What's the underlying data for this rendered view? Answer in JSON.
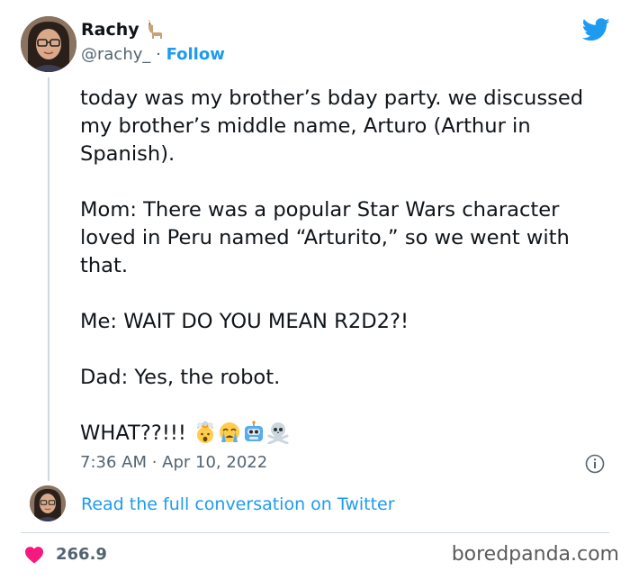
{
  "author": {
    "name": "Rachy",
    "name_emoji": "llama-icon",
    "handle": "@rachy_",
    "separator": " · ",
    "follow_label": "Follow"
  },
  "tweet": {
    "p1": "today was my brother’s bday party. we discussed my brother’s middle name, Arturo (Arthur in Spanish).",
    "p2": "Mom: There was a popular Star Wars character loved in Peru named “Arturito,” so we went with that.",
    "p3": "Me: WAIT DO YOU MEAN R2D2?!",
    "p4": "Dad: Yes, the robot.",
    "p5": "WHAT??!!! ",
    "emojis": [
      "exploding-head-icon",
      "crying-face-icon",
      "robot-icon",
      "skull-crossbones-icon"
    ],
    "timestamp": "7:36 AM · Apr 10, 2022"
  },
  "conversation": {
    "link_text": "Read the full conversation on Twitter"
  },
  "footer": {
    "like_count": "266.9",
    "like_count_suffix": "",
    "watermark": "boredpanda.com"
  },
  "colors": {
    "twitter_blue": "#1d9bf0",
    "text": "#0f1419",
    "muted": "#536471",
    "heart": "#f91880",
    "divider": "#cfd9de"
  }
}
